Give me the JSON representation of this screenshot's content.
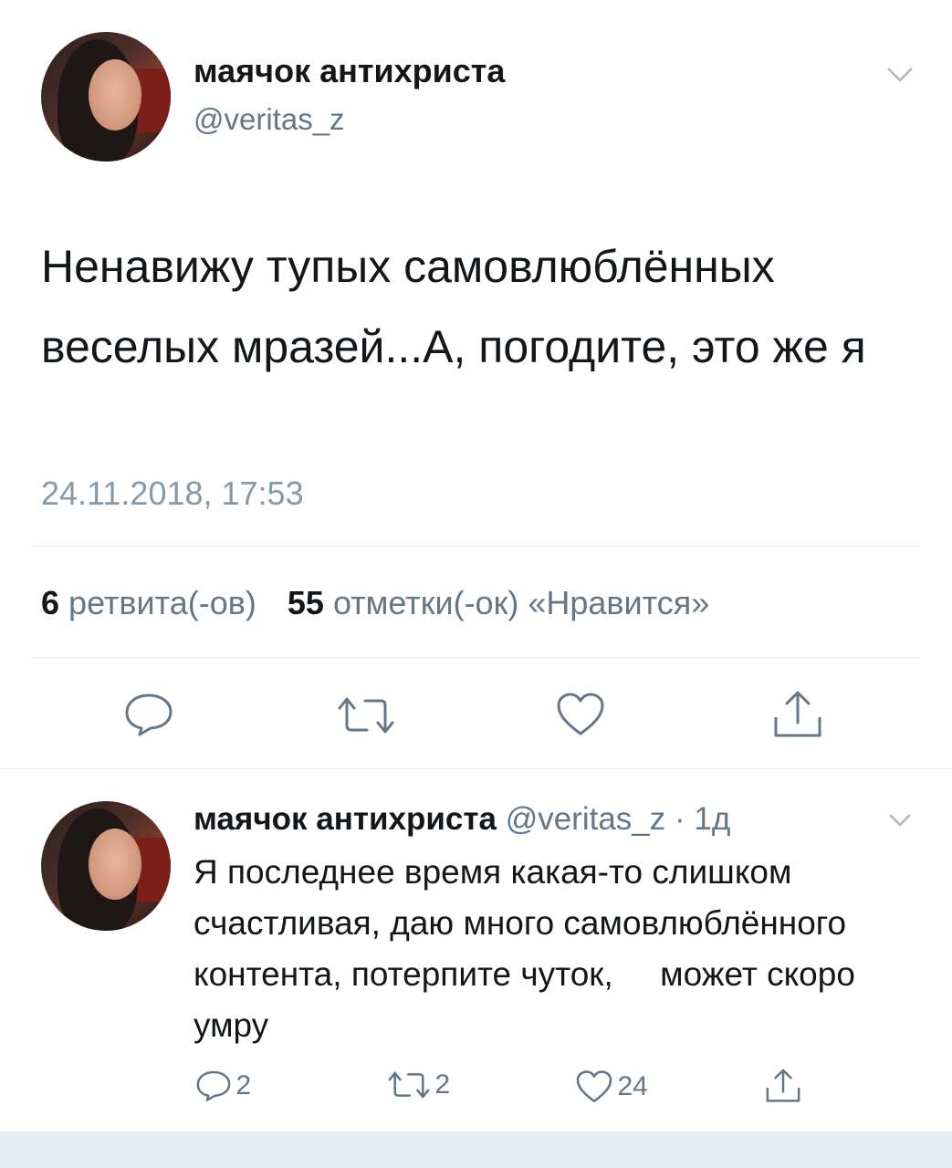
{
  "tweet": {
    "author_name": "маячок антихриста",
    "author_handle": "@veritas_z",
    "text": "Ненавижу тупых самовлюблённых веселых мразей...А, погодите, это же я",
    "timestamp": "24.11.2018, 17:53",
    "retweet_count": "6",
    "retweet_label": "ретвита(-ов)",
    "like_count": "55",
    "like_label": "отметки(-ок) «Нравится»",
    "icons": [
      "reply-icon",
      "retweet-icon",
      "like-icon",
      "share-icon"
    ]
  },
  "reply": {
    "author_name": "маячок антихриста",
    "author_handle": "@veritas_z",
    "time_ago": "· 1д",
    "text": "Я последнее время какая-то слишком счастливая, даю много самовлюблённого контента, потерпите чуток,     может скоро умру",
    "reply_count": "2",
    "retweet_count": "2",
    "like_count": "24",
    "icons": [
      "reply-icon",
      "retweet-icon",
      "like-icon",
      "share-icon"
    ]
  },
  "colors": {
    "text": "#14171a",
    "secondary": "#657786",
    "divider": "#e6ecf0",
    "icon": "#657786"
  }
}
